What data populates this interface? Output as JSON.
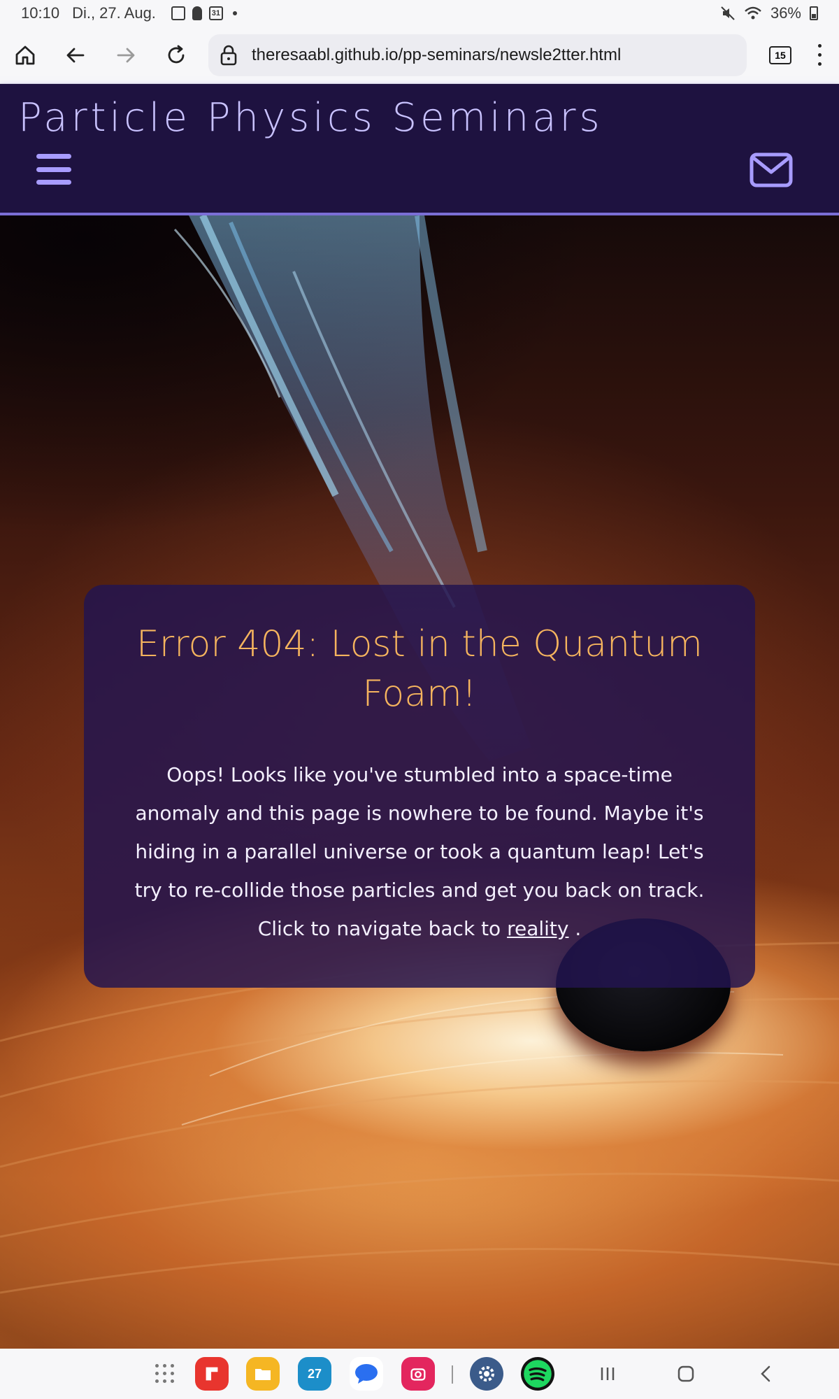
{
  "status_bar": {
    "time": "10:10",
    "date": "Di., 27. Aug.",
    "calendar_badge": "31",
    "battery": "36%"
  },
  "browser": {
    "url": "theresaabl.github.io/pp-seminars/newsle2tter.html",
    "tab_count": "15"
  },
  "site": {
    "title": "Particle Physics Seminars"
  },
  "error_card": {
    "title": "Error 404: Lost in the Quantum Foam!",
    "message": "Oops! Looks like you've stumbled into a space-time anomaly and this page is nowhere to be found. Maybe it's hiding in a parallel universe or took a quantum leap! Let's try to re-collide those particles and get you back on track. Click to navigate back to",
    "link_text": "reality",
    "after_link": " ."
  },
  "nav_bar": {
    "calendar_app_day": "27"
  },
  "colors": {
    "header_bg": "#1e1240",
    "header_accent": "#a89cff",
    "title_color": "#f5b45e",
    "card_bg": "rgba(35,20,80,0.84)"
  }
}
